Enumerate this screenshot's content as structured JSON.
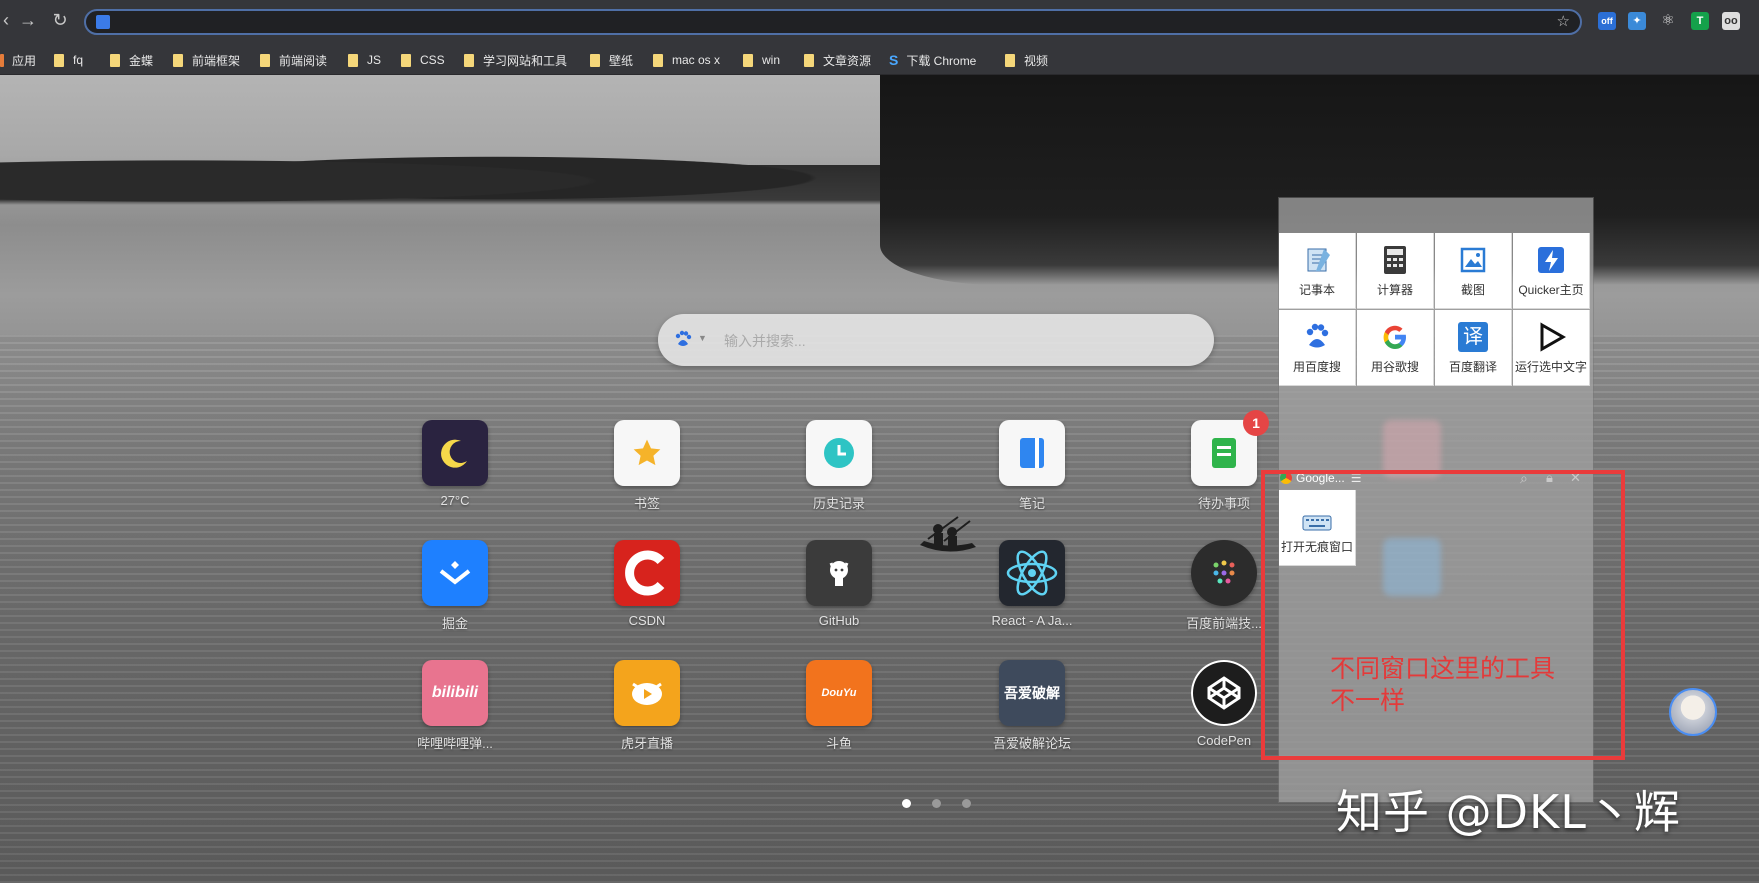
{
  "browser": {
    "url": "",
    "bookmarks": [
      "应用",
      "fq",
      "金蝶",
      "前端框架",
      "前端阅读",
      "JS",
      "CSS",
      "学习网站和工具",
      "壁纸",
      "mac os x",
      "win",
      "文章资源",
      "下载 Chrome",
      "视频"
    ],
    "extensions": [
      "off",
      "T",
      "oo"
    ]
  },
  "search": {
    "placeholder": "输入并搜索..."
  },
  "apps": {
    "weather": "27°C",
    "bookmarks": "书签",
    "history": "历史记录",
    "notes": "笔记",
    "todo": "待办事项",
    "todo_badge": "1",
    "juejin": "掘金",
    "csdn": "CSDN",
    "github": "GitHub",
    "react": "React - A Ja...",
    "baidu_fe": "百度前端技...",
    "bilibili": "哔哩哔哩弹...",
    "huya": "虎牙直播",
    "douyu": "斗鱼",
    "52pojie": "吾爱破解论坛",
    "codepen": "CodePen",
    "bilibili_logo": "bilibili",
    "douyu_logo": "DouYu",
    "52pojie_logo": "吾爱破解"
  },
  "quicker": {
    "actions": [
      "记事本",
      "计算器",
      "截图",
      "Quicker主页",
      "用百度搜",
      "用谷歌搜",
      "百度翻译",
      "运行选中文字"
    ],
    "window_title": "Google...",
    "window_action": "打开无痕窗口",
    "translate_glyph": "译"
  },
  "annotation": "不同窗口这里的工具不一样",
  "watermark": "知乎 @DKL丶辉",
  "colors": {
    "highlight": "#ea3b3b",
    "accent": "#4b8ef2"
  }
}
